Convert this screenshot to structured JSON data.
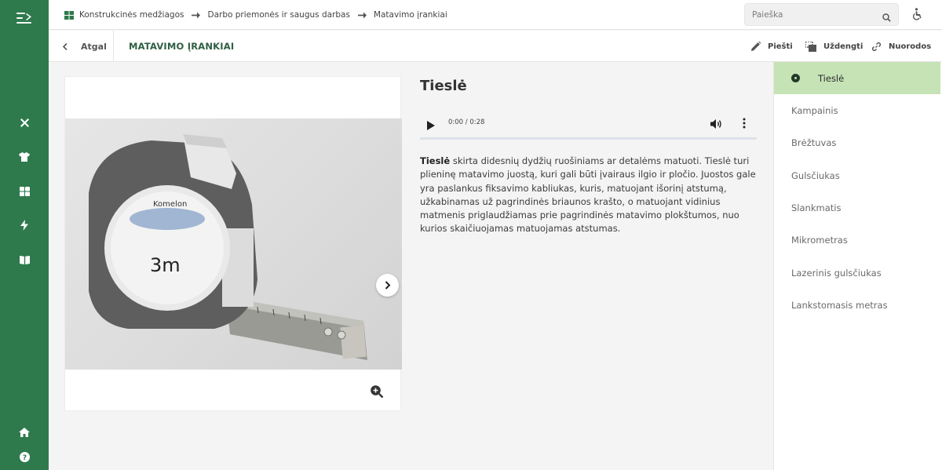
{
  "breadcrumb": {
    "items": [
      "Konstrukcinės medžiagos",
      "Darbo priemonės ir saugus darbas",
      "Matavimo įrankiai"
    ]
  },
  "search": {
    "placeholder": "Paieška"
  },
  "subheader": {
    "back_label": "Atgal",
    "title": "MATAVIMO ĮRANKIAI",
    "tools": {
      "draw": "Piešti",
      "cover": "Uždengti",
      "links": "Nuorodos"
    }
  },
  "content": {
    "title": "Tieslė",
    "audio": {
      "time": "0:00 / 0:28"
    },
    "description_term": "Tieslė",
    "description_rest": " skirta didesnių dydžių ruošiniams ar detalėms matuoti. Tieslė turi plieninę matavimo juostą, kuri gali būti įvairaus ilgio ir pločio. Juostos gale yra paslankus fiksavimo kabliukas, kuris, matuojant išorinį atstumą, užkabinamas už pagrindinės briaunos krašto, o matuojant vidinius matmenis priglaudžiamas prie pagrindinės matavimo plokštumos, nuo kurios skaičiuojamas matuojamas atstumas.",
    "image_text": {
      "brand": "Komelon",
      "size": "3m"
    }
  },
  "list": {
    "items": [
      "Tieslė",
      "Kampainis",
      "Brėžtuvas",
      "Gulsčiukas",
      "Slankmatis",
      "Mikrometras",
      "Lazerinis gulsčiukas",
      "Lankstomasis metras"
    ],
    "active_index": 0
  },
  "colors": {
    "sidebar": "#2e7a4c",
    "title_green": "#2f5f43",
    "active_item": "#c6e3b6"
  }
}
